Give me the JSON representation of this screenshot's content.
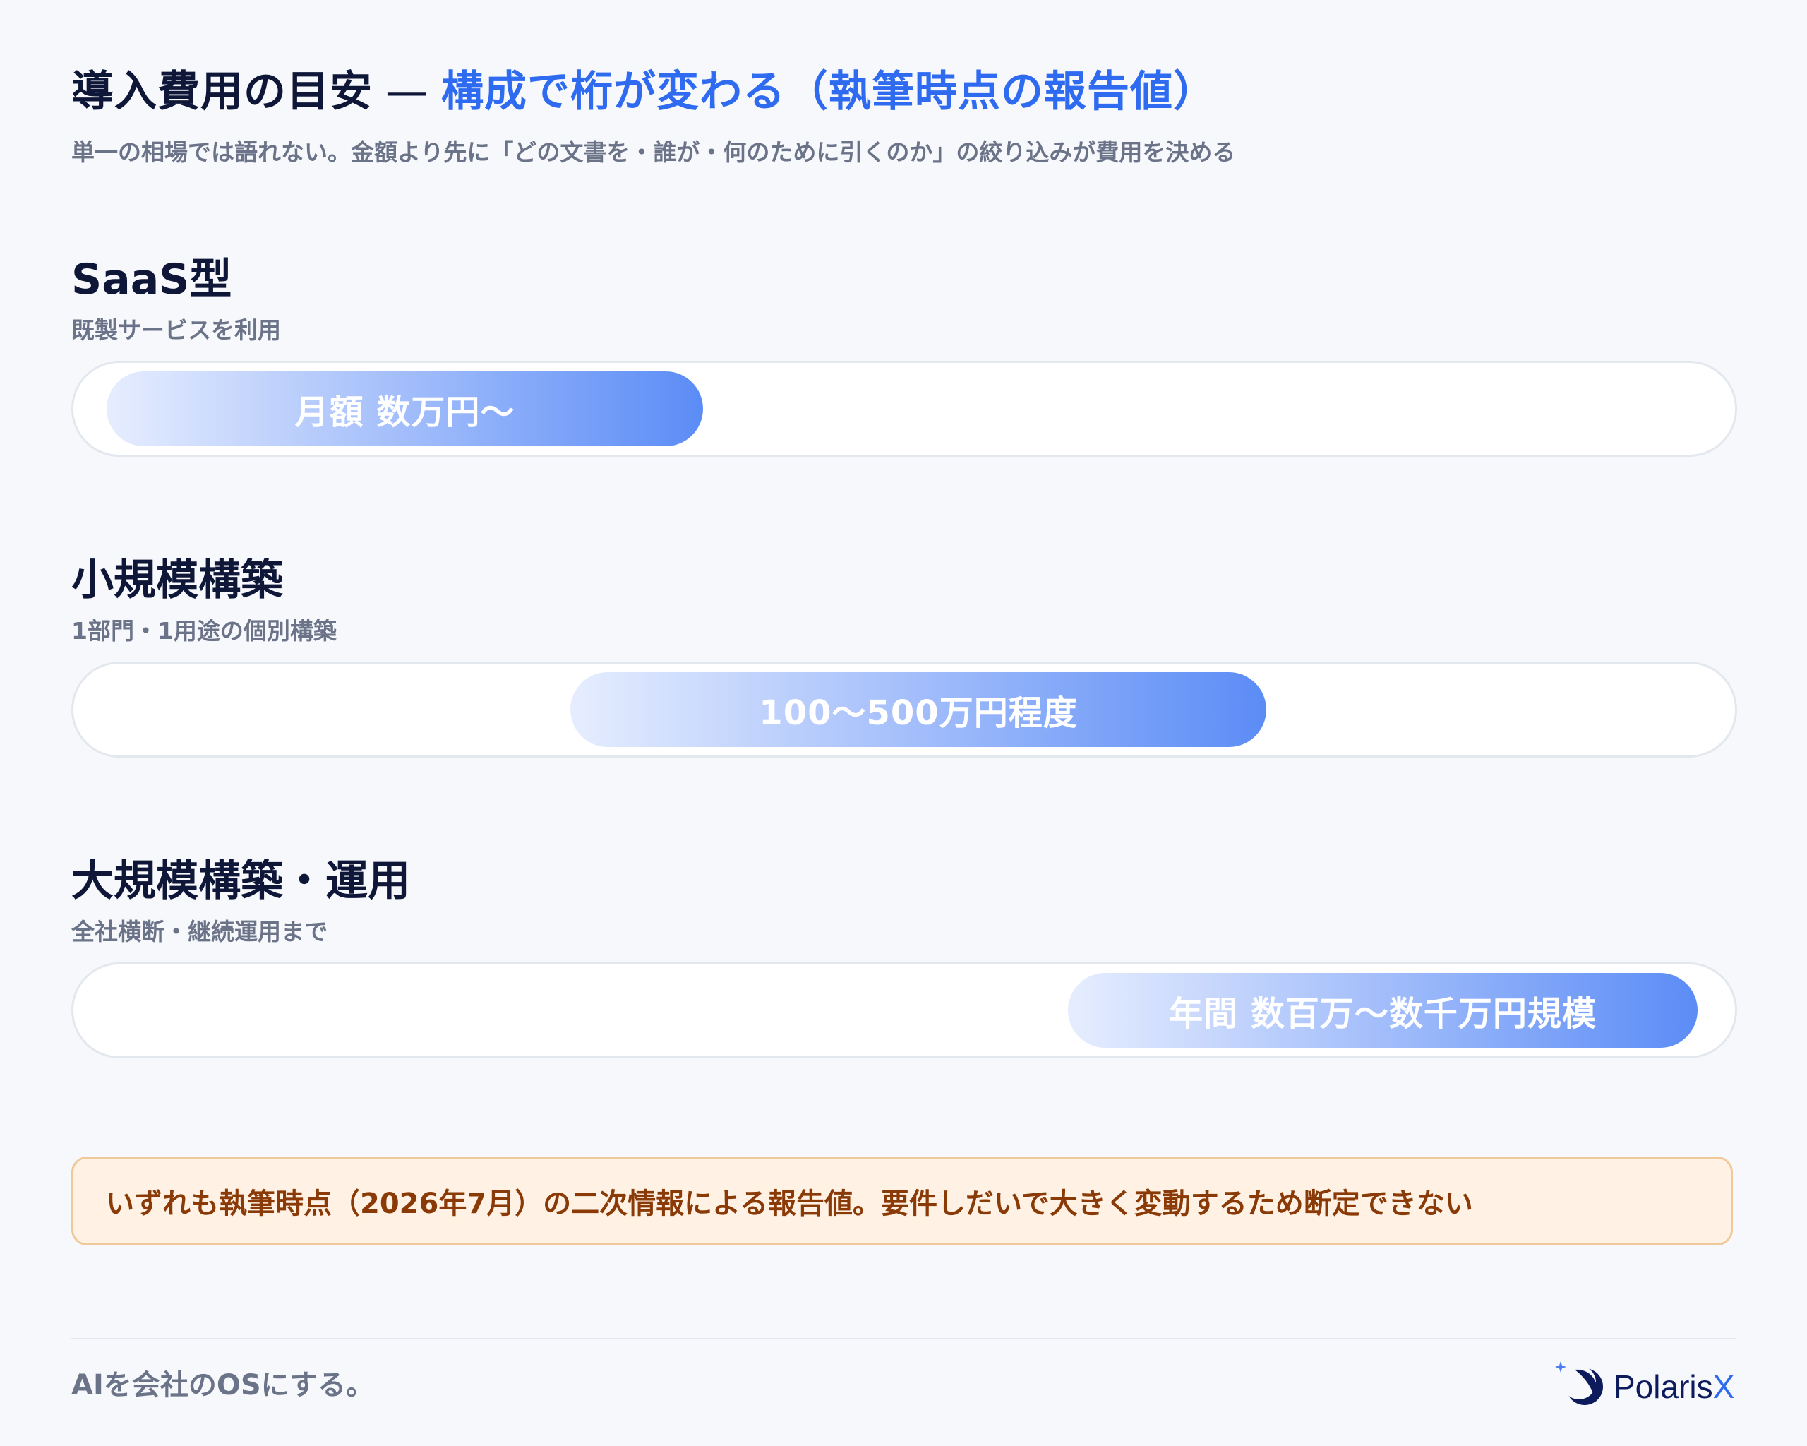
{
  "header": {
    "title_main": "導入費用の目安",
    "title_dash": "—",
    "title_accent": "構成で桁が変わる（執筆時点の報告値）",
    "subtitle": "単一の相場では語れない。金額より先に「どの文書を・誰が・何のために引くのか」の絞り込みが費用を決める"
  },
  "sections": [
    {
      "title": "SaaS型",
      "subtitle": "既製サービスを利用",
      "range_label": "月額 数万円〜",
      "range": [
        0.02,
        0.38
      ]
    },
    {
      "title": "小規模構築",
      "subtitle": "1部門・1用途の個別構築",
      "range_label": "100〜500万円程度",
      "range": [
        0.3,
        0.72
      ]
    },
    {
      "title": "大規模構築・運用",
      "subtitle": "全社横断・継続運用まで",
      "range_label": "年間 数百万〜数千万円規模",
      "range": [
        0.6,
        0.98
      ]
    }
  ],
  "colors": {
    "accent": "#2f6bf0",
    "bar_start": "#e6edfe",
    "bar_end": "#5b8cf6",
    "note_bg": "#fff2e4",
    "note_text": "#8a3a06"
  },
  "note": {
    "text": "いずれも執筆時点（2026年7月）の二次情報による報告値。要件しだいで大きく変動するため断定できない"
  },
  "footer": {
    "tagline": "AIを会社のOSにする。",
    "logo_word": "Polaris",
    "logo_x": "X",
    "logo_icon": "polaris-star-icon"
  }
}
